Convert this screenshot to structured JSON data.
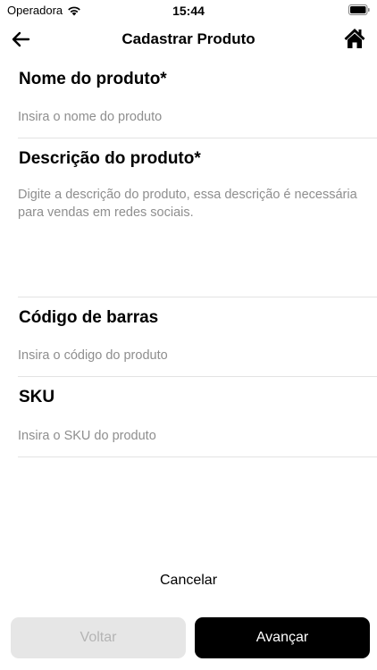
{
  "status_bar": {
    "carrier": "Operadora",
    "time": "15:44"
  },
  "header": {
    "title": "Cadastrar Produto"
  },
  "fields": [
    {
      "label": "Nome do produto*",
      "placeholder": "Insira o nome do produto"
    },
    {
      "label": "Descrição do produto*",
      "placeholder": "Digite a descrição do produto, essa descrição é necessária para vendas em redes sociais."
    },
    {
      "label": "Código de barras",
      "placeholder": "Insira o código do produto"
    },
    {
      "label": "SKU",
      "placeholder": "Insira o SKU do produto"
    }
  ],
  "footer": {
    "cancel_label": "Cancelar",
    "back_label": "Voltar",
    "next_label": "Avançar"
  }
}
